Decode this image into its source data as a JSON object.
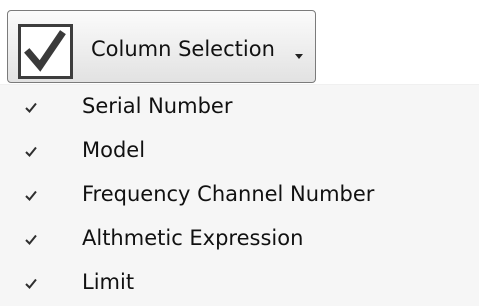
{
  "button": {
    "label": "Column Selection",
    "checked": true
  },
  "menu": {
    "items": [
      {
        "label": "Serial Number",
        "checked": true
      },
      {
        "label": "Model",
        "checked": true
      },
      {
        "label": "Frequency Channel Number",
        "checked": true
      },
      {
        "label": "Althmetic Expression",
        "checked": true
      },
      {
        "label": "Limit",
        "checked": true
      }
    ]
  },
  "colors": {
    "menu_background": "#f6f6f6",
    "button_border": "#7b7b7b",
    "check_color": "#3a3a3a",
    "text_color": "#111111"
  },
  "icons": {
    "button_check": "checkbox-icon",
    "item_check": "checkmark-icon",
    "dropdown": "chevron-down-icon"
  }
}
